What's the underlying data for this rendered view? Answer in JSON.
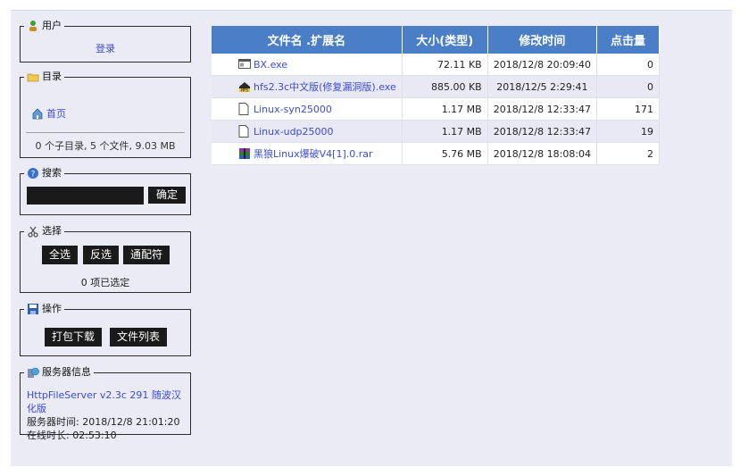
{
  "user": {
    "title": "用户",
    "login": "登录"
  },
  "folder": {
    "title": "目录",
    "home": "首页",
    "summary": "0 个子目录, 5 个文件, 9.03 MB"
  },
  "search": {
    "title": "搜索",
    "button": "确定",
    "value": ""
  },
  "select": {
    "title": "选择",
    "all": "全选",
    "invert": "反选",
    "wildcard": "通配符",
    "count": "0 项已选定"
  },
  "actions": {
    "title": "操作",
    "archive": "打包下载",
    "list": "文件列表"
  },
  "server": {
    "title": "服务器信息",
    "version": "HttpFileServer v2.3c 291 随波汉化版",
    "time": "服务器时间: 2018/12/8 21:01:20",
    "uptime": "在线时长: 02:53:10"
  },
  "table": {
    "headers": [
      "文件名 .扩展名",
      "大小(类型)",
      "修改时间",
      "点击量"
    ],
    "rows": [
      {
        "name": "BX.exe",
        "icon": "exe-window-icon",
        "size": "72.11 KB",
        "date": "2018/12/8 20:09:40",
        "hits": "0"
      },
      {
        "name": "hfs2.3c中文版(修复漏洞版).exe",
        "icon": "hfs-icon",
        "size": "885.00 KB",
        "date": "2018/12/5 2:29:41",
        "hits": "0"
      },
      {
        "name": "Linux-syn25000",
        "icon": "file-icon",
        "size": "1.17 MB",
        "date": "2018/12/8 12:33:47",
        "hits": "171"
      },
      {
        "name": "Linux-udp25000",
        "icon": "file-icon",
        "size": "1.17 MB",
        "date": "2018/12/8 12:33:47",
        "hits": "19"
      },
      {
        "name": "黑狼Linux爆破V4[1].0.rar",
        "icon": "rar-icon",
        "size": "5.76 MB",
        "date": "2018/12/8 18:08:04",
        "hits": "2"
      }
    ]
  }
}
